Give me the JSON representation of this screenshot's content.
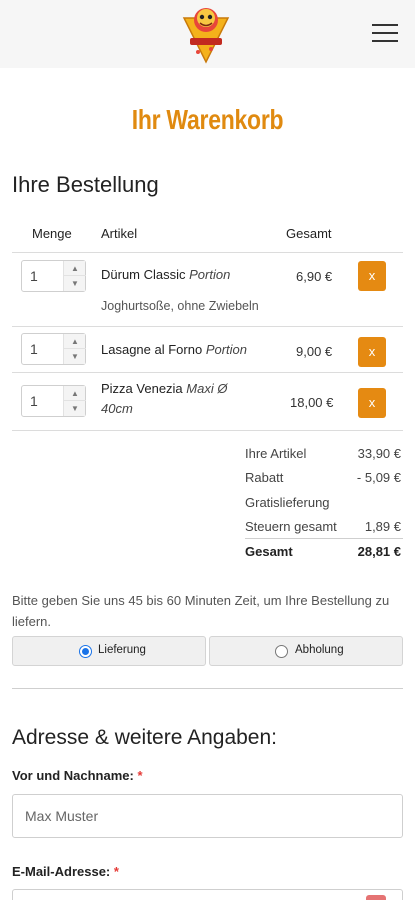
{
  "header": {
    "logo_icon": "pizza-mascot-logo",
    "menu_icon": "hamburger-icon"
  },
  "page_title": "Ihr Warenkorb",
  "order": {
    "title": "Ihre Bestellung",
    "columns": {
      "quantity": "Menge",
      "item": "Artikel",
      "total": "Gesamt"
    },
    "items": [
      {
        "qty": "1",
        "name": "Dürum Classic",
        "variant": "Portion",
        "note": "Joghurtsoße, ohne Zwiebeln",
        "price": "6,90 €",
        "delete_label": "x"
      },
      {
        "qty": "1",
        "name": "Lasagne al Forno",
        "variant": "Portion",
        "note": "",
        "price": "9,00 €",
        "delete_label": "x"
      },
      {
        "qty": "1",
        "name": "Pizza Venezia",
        "variant": "Maxi Ø 40cm",
        "note": "",
        "price": "18,00 €",
        "delete_label": "x"
      }
    ],
    "summary": {
      "items_label": "Ihre Artikel",
      "items_value": "33,90 €",
      "discount_label": "Rabatt",
      "discount_value": "- 5,09 €",
      "delivery_label": "Gratislieferung",
      "tax_label": "Steuern gesamt",
      "tax_value": "1,89 €",
      "total_label": "Gesamt",
      "total_value": "28,81 €"
    }
  },
  "delivery_info": "Bitte geben Sie uns 45 bis 60 Minuten Zeit, um Ihre Bestellung zu liefern.",
  "delivery_options": [
    {
      "label": "Lieferung",
      "selected": true
    },
    {
      "label": "Abholung",
      "selected": false
    }
  ],
  "address": {
    "title": "Adresse & weitere Angaben:",
    "name_label": "Vor und Nachname:",
    "name_placeholder": "Max Muster",
    "email_label": "E-Mail-Adresse:",
    "required_mark": "*"
  },
  "colors": {
    "accent": "#e58a12",
    "title": "#e08a10",
    "required": "#e53935",
    "radio": "#1a73e8"
  }
}
